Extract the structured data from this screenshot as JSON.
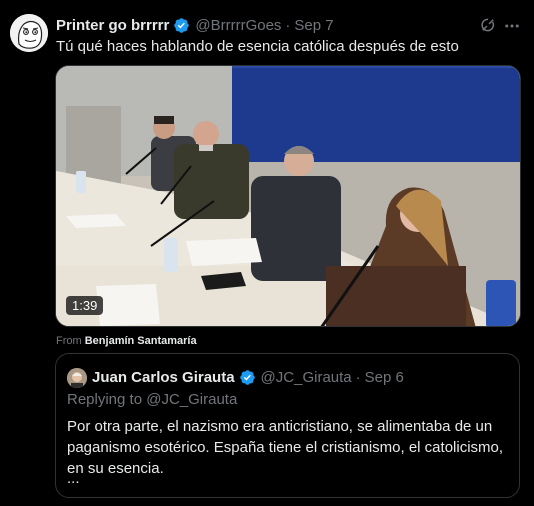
{
  "tweet": {
    "display_name": "Printer go brrrrr",
    "handle": "@BrrrrrGoes",
    "separator": "·",
    "date": "Sep 7",
    "text": "Tú qué haces hablando de esencia católica después de esto",
    "avatar_icon": "meme-face-avatar",
    "verified_icon": "verified-badge-icon",
    "verified_color": "#1d9bf0",
    "grok_icon": "grok-icon",
    "more_icon": "more-icon"
  },
  "media": {
    "timestamp": "1:39",
    "from_prefix": "From",
    "from_source": "Benjamín Santamaría"
  },
  "quote": {
    "display_name": "Juan Carlos Girauta",
    "handle": "@JC_Girauta",
    "separator": "·",
    "date": "Sep 6",
    "replying_prefix": "Replying to",
    "replying_handle": "@JC_Girauta",
    "text": "Por otra parte, el nazismo era anticristiano, se alimentaba de un paganismo esotérico. España tiene el cristianismo, el catolicismo, en su esencia.",
    "ellipsis": "..."
  }
}
